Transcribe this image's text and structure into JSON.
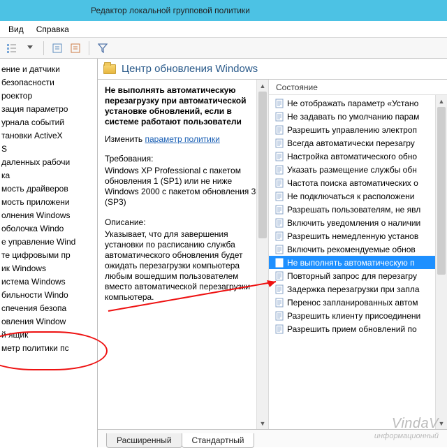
{
  "window": {
    "title": "Редактор локальной групповой политики"
  },
  "menu": {
    "view": "Вид",
    "help": "Справка"
  },
  "tree": {
    "items": [
      "ение и датчики",
      "безопасности",
      "роектор",
      "зация параметро",
      "урнала событий",
      "тановки ActiveX",
      "S",
      "даленных рабочи",
      "ка",
      "мость драйверов",
      "мость приложени",
      "олнения Windows",
      "оболочка Windo",
      "е управление Wind",
      "те цифровыми пр",
      "ик Windows",
      "истема Windows",
      "бильности Windo",
      "спечения безопа",
      "овления Window",
      "й ящик",
      "метр политики пс"
    ]
  },
  "header": {
    "title": "Центр обновления Windows"
  },
  "desc": {
    "title": "Не выполнять автоматическую перезагрузку при автоматической установке обновлений, если в системе работают пользователи",
    "edit_label": "Изменить",
    "edit_link": "параметр политики",
    "req_label": "Требования:",
    "req_text": "Windows XP Professional с пакетом обновления 1 (SP1) или не ниже Windows 2000 с пакетом обновления 3 (SP3)",
    "desc_label": "Описание:",
    "desc_text": "Указывает, что для завершения установки по расписанию служба автоматического обновления будет ожидать перезагрузки компьютера любым вошедшим пользователем вместо автоматической перезагрузки компьютера."
  },
  "list": {
    "col_state": "Состояние",
    "items": [
      "Не отображать параметр «Устано",
      "Не задавать по умолчанию парам",
      "Разрешить управлению электроп",
      "Всегда автоматически перезагру",
      "Настройка автоматического обно",
      "Указать размещение службы обн",
      "Частота поиска автоматических о",
      "Не подключаться к расположени",
      "Разрешать пользователям, не явл",
      "Включить уведомления о наличии",
      "Разрешить немедленную установ",
      "Включить рекомендуемые обнов",
      "Не выполнять автоматическую п",
      "Повторный запрос для перезагру",
      "Задержка перезагрузки при запла",
      "Перенос запланированных автом",
      "Разрешить клиенту присоединени",
      "Разрешить прием обновлений по"
    ],
    "selected_index": 12
  },
  "tabs": {
    "extended": "Расширенный",
    "standard": "Стандартный"
  },
  "watermark": {
    "line1": "VindaV",
    "line2": "информационный"
  }
}
